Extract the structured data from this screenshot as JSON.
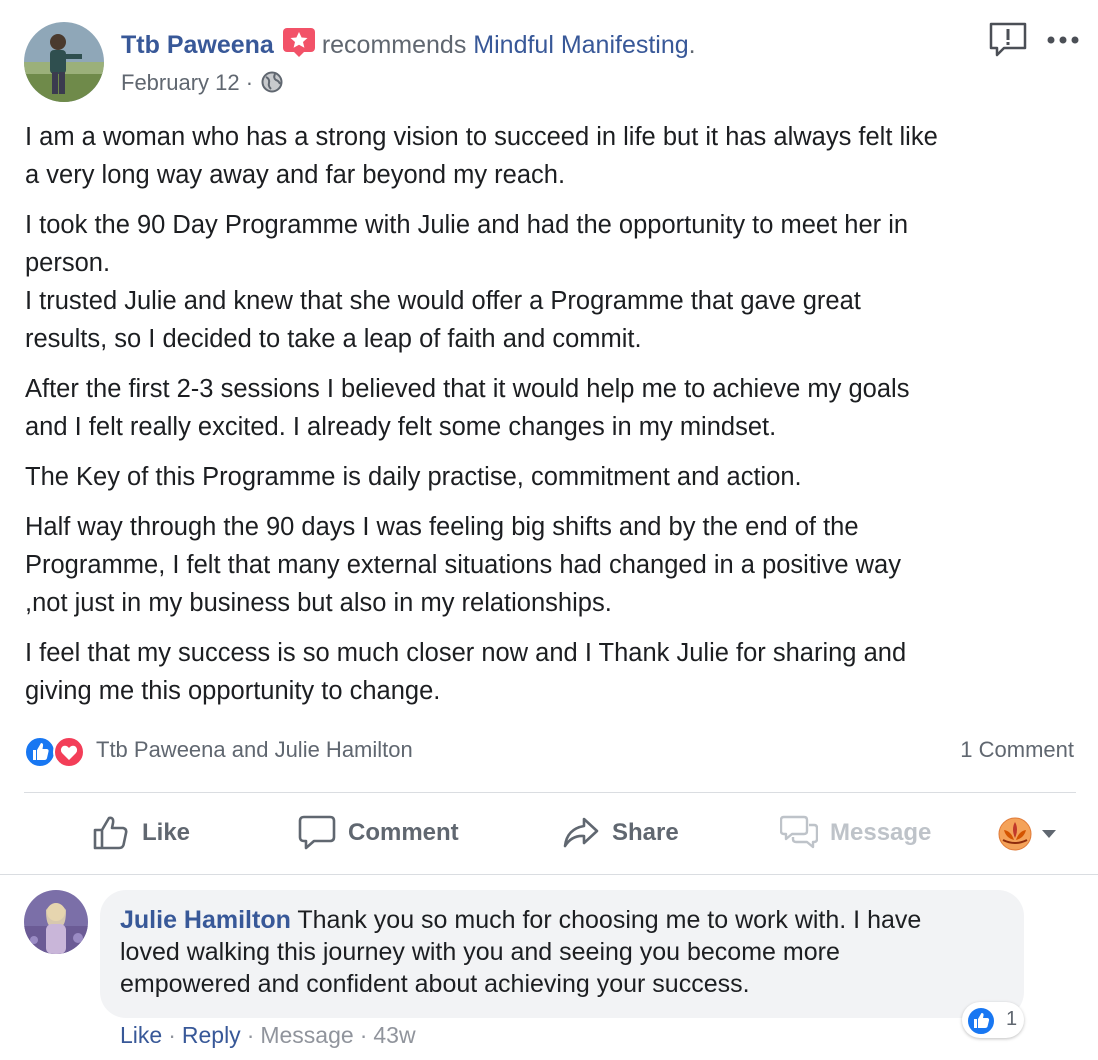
{
  "post": {
    "author": "Ttb Paweena",
    "verb": "recommends",
    "page": "Mindful Manifesting",
    "period": ".",
    "date": "February 12",
    "date_sep": "·",
    "privacy_icon": "globe-icon",
    "paragraphs": [
      [
        "I am a woman who has a strong vision to succeed in life but it has always felt like",
        "a very long way away and far beyond my reach."
      ],
      [
        "I took the 90 Day Programme with Julie and had the opportunity to meet her in",
        "person.",
        "I trusted Julie and knew that she would offer a Programme that gave great",
        "results, so I decided to take a leap of faith and commit."
      ],
      [
        "After the first 2-3 sessions I believed that it would help me to achieve my goals",
        "and I felt really excited. I already felt some changes in my mindset."
      ],
      [
        "The Key of this Programme is daily practise, commitment and action."
      ],
      [
        "Half way through the 90 days I was feeling big shifts and by the end of the",
        "Programme, I felt that many external situations had changed in a positive way",
        ",not just in my business but also in my relationships."
      ],
      [
        "I feel that my success is so much closer now and I Thank Julie for sharing and",
        "giving me this opportunity to change."
      ]
    ]
  },
  "reactions": {
    "names": "Ttb Paweena and Julie Hamilton",
    "comment_count": "1 Comment",
    "icons": [
      "like-icon",
      "love-icon"
    ],
    "like_color": "#1877f2",
    "love_color": "#f33e58"
  },
  "actions": {
    "like": "Like",
    "comment": "Comment",
    "share": "Share",
    "message": "Message"
  },
  "comment": {
    "author": "Julie Hamilton",
    "lines": [
      "Thank you so much for choosing me to work with. I have",
      "loved walking this journey with you and seeing you become more",
      "empowered and confident about achieving your success."
    ],
    "like": "Like",
    "reply": "Reply",
    "message": "Message",
    "time": "43w",
    "sep": "·",
    "reaction_count": "1"
  },
  "colors": {
    "link": "#385898",
    "secondary_text": "#606770",
    "badge": "#f25268"
  }
}
